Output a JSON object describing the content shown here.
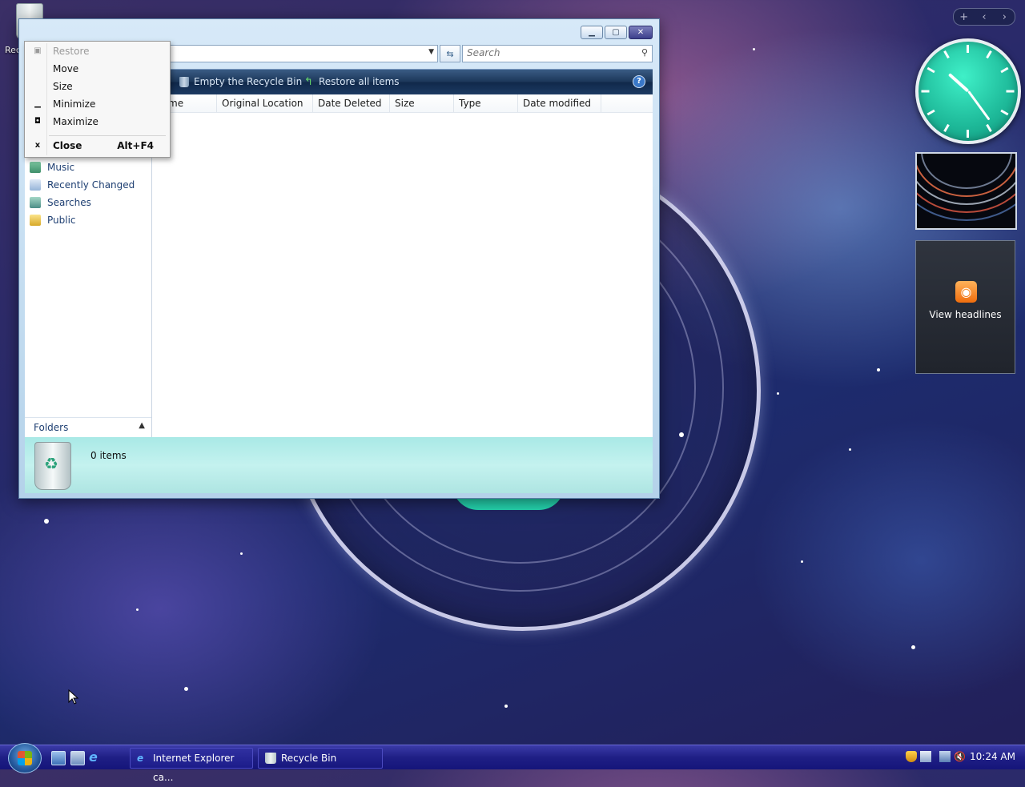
{
  "desktop": {
    "recycle_bin_label": "Rec"
  },
  "window": {
    "search_placeholder": "Search",
    "toolbar": {
      "empty_label": "Empty the Recycle Bin",
      "restore_label": "Restore all items",
      "help_label": "?"
    },
    "nav_items": [
      {
        "label": "Music",
        "icon": "music-folder-icon"
      },
      {
        "label": "Recently Changed",
        "icon": "recently-changed-icon"
      },
      {
        "label": "Searches",
        "icon": "searches-icon"
      },
      {
        "label": "Public",
        "icon": "public-folder-icon"
      }
    ],
    "folders_label": "Folders",
    "columns": [
      "me",
      "Original Location",
      "Date Deleted",
      "Size",
      "Type",
      "Date modified"
    ],
    "details": {
      "count": "0 items"
    }
  },
  "system_menu": {
    "items": [
      {
        "label": "Restore",
        "enabled": false
      },
      {
        "label": "Move",
        "enabled": true
      },
      {
        "label": "Size",
        "enabled": true
      },
      {
        "label": "Minimize",
        "enabled": true
      },
      {
        "label": "Maximize",
        "enabled": true
      },
      {
        "label": "Close",
        "shortcut": "Alt+F4",
        "enabled": true
      }
    ]
  },
  "gadgets": {
    "add_label": "+",
    "feed_label": "View headlines"
  },
  "taskbar": {
    "tasks": [
      {
        "label": "Internet Explorer ca..."
      },
      {
        "label": "Recycle Bin"
      }
    ],
    "clock": "10:24 AM"
  },
  "colors": {
    "taskbar": "#1f1f85",
    "details_pane": "#b4ece9",
    "clock_face": "#1db898"
  }
}
